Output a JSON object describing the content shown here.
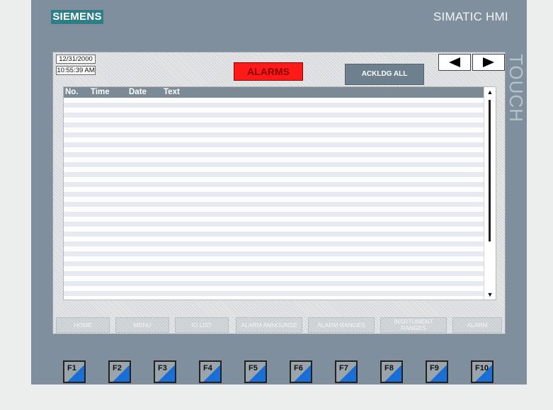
{
  "header": {
    "brand": "SIEMENS",
    "title": "SIMATIC HMI",
    "touch_label": "TOUCH"
  },
  "screen": {
    "date": "12/31/2000",
    "time": "10:55:39 AM",
    "title": "ALARMS",
    "ack_button": "ACKLDG ALL",
    "nav_prev_icon": "triangle-left-icon",
    "nav_next_icon": "triangle-right-icon"
  },
  "alarm_table": {
    "columns": [
      "No.",
      "Time",
      "Date",
      "Text"
    ],
    "rows": []
  },
  "softkeys": [
    {
      "label": "HOME"
    },
    {
      "label": "MENU"
    },
    {
      "label": "IO LIST"
    },
    {
      "label": "ALARM ANNOUNSE"
    },
    {
      "label": "ALARM RANGES"
    },
    {
      "label": "INSRTUMENT RANGES"
    },
    {
      "label": "ALARM"
    }
  ],
  "function_keys": [
    "F1",
    "F2",
    "F3",
    "F4",
    "F5",
    "F6",
    "F7",
    "F8",
    "F9",
    "F10"
  ],
  "colors": {
    "bezel": "#7f8f9d",
    "brand_bg": "#2f7d86",
    "alarm_red": "#ff1a1a",
    "fkey_accent": "#1a6fd6"
  }
}
